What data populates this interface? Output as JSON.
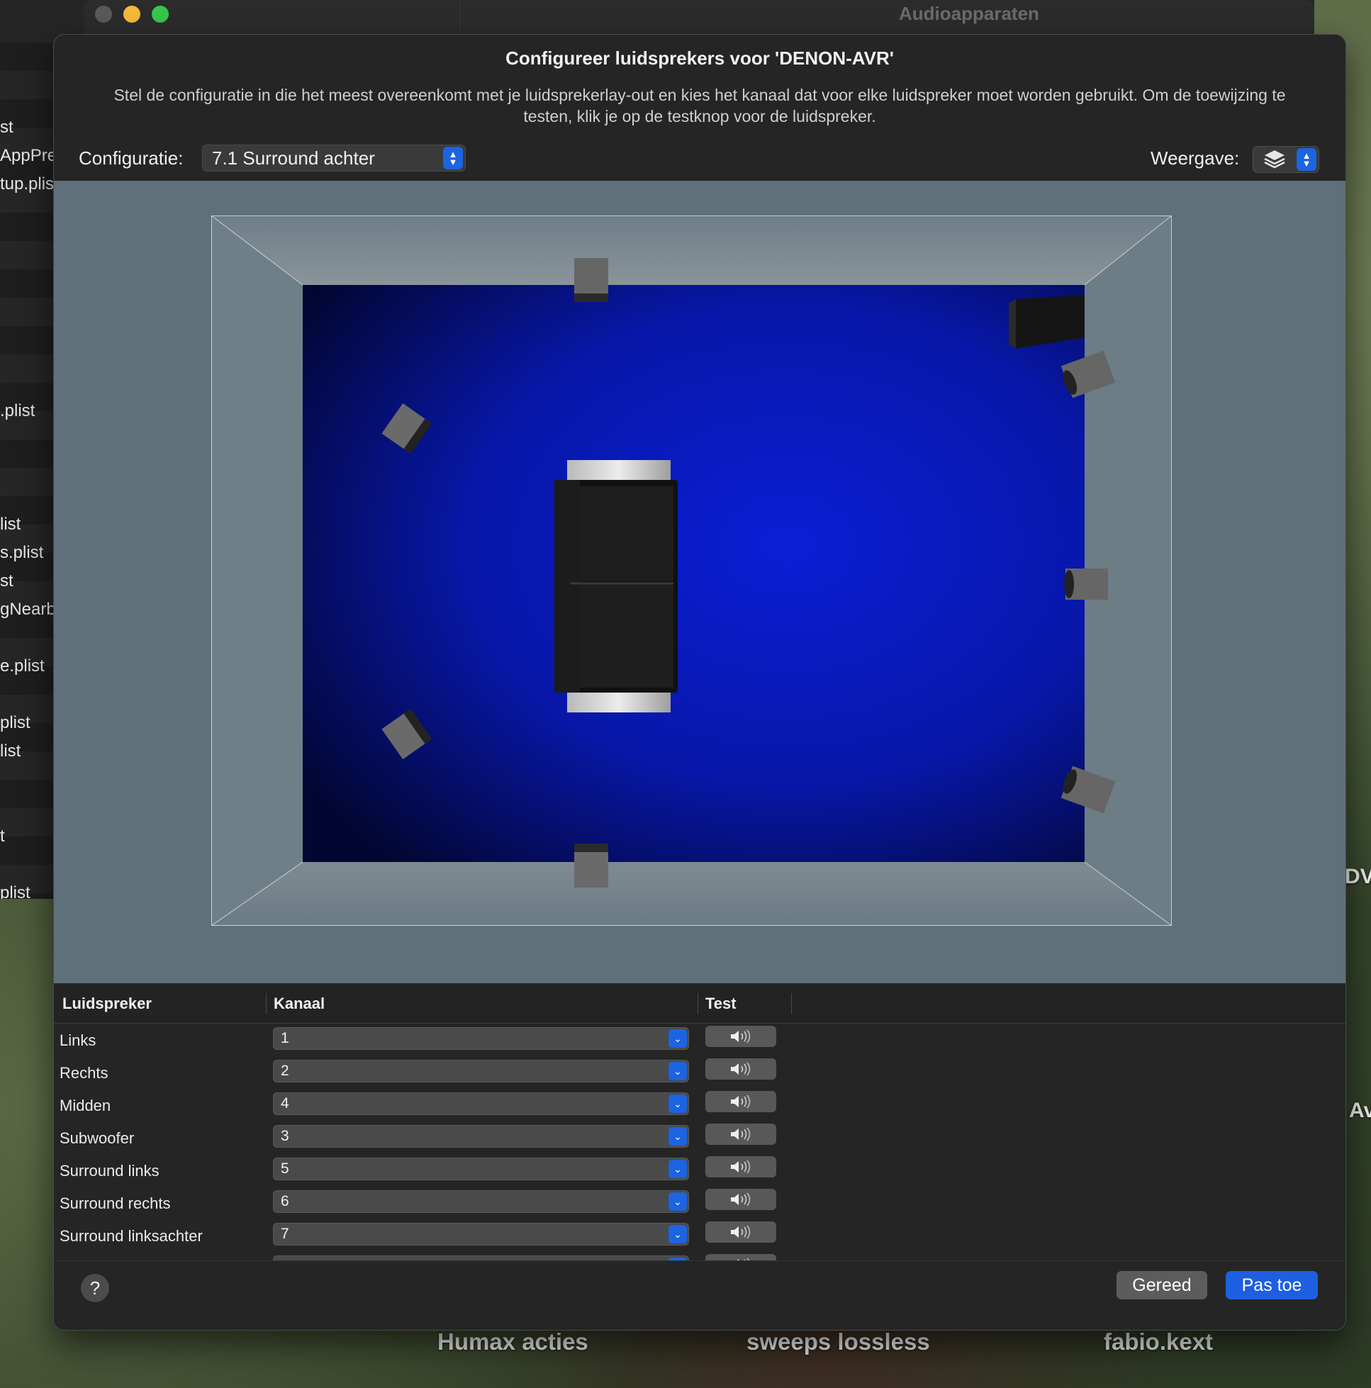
{
  "background_window": {
    "title": "Audioapparaten",
    "file_list": [
      "st",
      "AppPre",
      "tup.plis",
      ".plist",
      "list",
      "s.plist",
      "st",
      "gNearb",
      "e.plist",
      "plist",
      "list",
      "t",
      "plist"
    ]
  },
  "desktop": {
    "icons": [
      "Humax acties",
      "sweeps lossless",
      "fabio.kext"
    ],
    "edge_labels": [
      "DV",
      "Av"
    ]
  },
  "sheet": {
    "title": "Configureer luidsprekers voor 'DENON-AVR'",
    "description": "Stel de configuratie in die het meest overeenkomt met je luidsprekerlay-out en kies het kanaal dat voor elke luidspreker moet worden gebruikt. Om de toewijzing te testen, klik je op de testknop voor de luidspreker.",
    "configuration_label": "Configuratie:",
    "configuration_value": "7.1 Surround achter",
    "view_label": "Weergave:",
    "view_icon": "layers-icon"
  },
  "table": {
    "headers": {
      "speaker": "Luidspreker",
      "channel": "Kanaal",
      "test": "Test"
    },
    "rows": [
      {
        "speaker": "Links",
        "channel": "1"
      },
      {
        "speaker": "Rechts",
        "channel": "2"
      },
      {
        "speaker": "Midden",
        "channel": "4"
      },
      {
        "speaker": "Subwoofer",
        "channel": "3"
      },
      {
        "speaker": "Surround links",
        "channel": "5"
      },
      {
        "speaker": "Surround rechts",
        "channel": "6"
      },
      {
        "speaker": "Surround linksachter",
        "channel": "7"
      }
    ],
    "test_icon": "speaker-volume-icon"
  },
  "footer": {
    "help_label": "?",
    "done_label": "Gereed",
    "apply_label": "Pas toe"
  },
  "colors": {
    "accent": "#1c64e0",
    "floor": "#0a1cc8",
    "room_bg": "#5e707a"
  }
}
